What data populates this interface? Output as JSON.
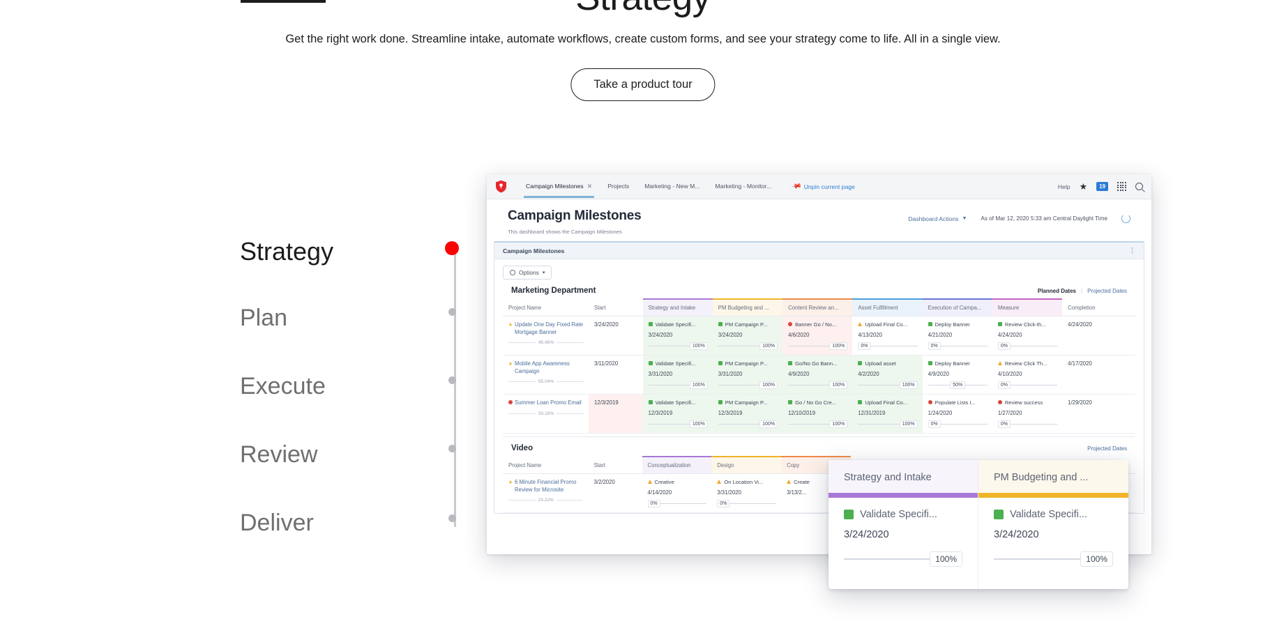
{
  "hero": {
    "title": "Strategy",
    "subtitle": "Get the right work done. Streamline intake, automate workflows, create custom forms, and see your strategy come to life. All in a single view.",
    "cta": "Take a product tour"
  },
  "stepper": {
    "items": [
      {
        "label": "Strategy",
        "active": true
      },
      {
        "label": "Plan",
        "active": false
      },
      {
        "label": "Execute",
        "active": false
      },
      {
        "label": "Review",
        "active": false
      },
      {
        "label": "Deliver",
        "active": false
      }
    ]
  },
  "app": {
    "nav": {
      "logo": "shield-logo-icon",
      "tabs": [
        {
          "label": "Campaign Milestones",
          "active": true,
          "closable": true
        },
        {
          "label": "Projects",
          "active": false,
          "closable": false
        },
        {
          "label": "Marketing - New M...",
          "active": false,
          "closable": false
        },
        {
          "label": "Marketing - Monitor...",
          "active": false,
          "closable": false
        }
      ],
      "unpin_label": "Unpin current page",
      "help_label": "Help",
      "badge_count": "19",
      "icons": [
        "pin-icon",
        "star-icon",
        "notification-badge",
        "grid-icon",
        "search-icon"
      ]
    },
    "header": {
      "title": "Campaign Milestones",
      "subtitle": "This dashboard shows the Campaign Milestones",
      "actions_label": "Dashboard Actions",
      "as_of": "As of  Mar 12, 2020 5:33 am Central Daylight Time",
      "refresh_icon": "refresh-icon"
    },
    "panel": {
      "title": "Campaign Milestones",
      "info_icon": "info-icon",
      "options_label": "Options"
    },
    "dates_toggle": {
      "planned": "Planned Dates",
      "projected": "Projected Dates",
      "separator": "|"
    },
    "marketing": {
      "section_title": "Marketing Department",
      "columns": [
        {
          "label": "Project Name",
          "color": "",
          "bg": "bg-white"
        },
        {
          "label": "Start",
          "color": "",
          "bg": "bg-white"
        },
        {
          "label": "Strategy and Intake",
          "color": "#a779d6",
          "bg": "bg-purple"
        },
        {
          "label": "PM Budgeting and ...",
          "color": "#f0b429",
          "bg": "bg-yellow"
        },
        {
          "label": "Content Review an...",
          "color": "#f08a4b",
          "bg": "bg-orange"
        },
        {
          "label": "Asset Fulfillment",
          "color": "#4a9fe0",
          "bg": "bg-blue"
        },
        {
          "label": "Execution of Campa...",
          "color": "#6b74d6",
          "bg": "bg-indigo"
        },
        {
          "label": "Measure",
          "color": "#c864c0",
          "bg": "bg-pink"
        },
        {
          "label": "Completion",
          "color": "",
          "bg": "bg-white"
        }
      ],
      "rows": [
        {
          "project": "Update One Day Fixed Rate Mortgage Banner",
          "project_pct": "45.45%",
          "start": "3/24/2020",
          "completion": "4/24/2020",
          "cells": [
            {
              "status": "sq-green",
              "task": "Validate Specifi...",
              "date": "3/24/2020",
              "pct": "100%",
              "bg": "bg-green"
            },
            {
              "status": "sq-green",
              "task": "PM Campaign P...",
              "date": "3/24/2020",
              "pct": "100%",
              "bg": "bg-green"
            },
            {
              "status": "cir-red",
              "task": "Banner Go / No...",
              "date": "4/6/2020",
              "pct": "100%",
              "bg": "bg-red"
            },
            {
              "status": "tri-orange",
              "task": "Upload Final Co...",
              "date": "4/13/2020",
              "pct": "0%",
              "bg": "bg-white"
            },
            {
              "status": "sq-green",
              "task": "Deploy Banner",
              "date": "4/21/2020",
              "pct": "0%",
              "bg": "bg-white"
            },
            {
              "status": "sq-green",
              "task": "Review Click-th...",
              "date": "4/24/2020",
              "pct": "0%",
              "bg": "bg-white"
            }
          ]
        },
        {
          "project": "Mobile App Awareness Campaign",
          "project_pct": "55.04%",
          "start": "3/11/2020",
          "completion": "4/17/2020",
          "cells": [
            {
              "status": "sq-green",
              "task": "Validate Specifi...",
              "date": "3/31/2020",
              "pct": "100%",
              "bg": "bg-green"
            },
            {
              "status": "sq-green",
              "task": "PM Campaign P...",
              "date": "3/31/2020",
              "pct": "100%",
              "bg": "bg-green"
            },
            {
              "status": "sq-green",
              "task": "Go/No Go Bann...",
              "date": "4/9/2020",
              "pct": "100%",
              "bg": "bg-green"
            },
            {
              "status": "sq-green",
              "task": "Upload asset",
              "date": "4/2/2020",
              "pct": "100%",
              "bg": "bg-green"
            },
            {
              "status": "sq-green",
              "task": "Deploy Banner",
              "date": "4/9/2020",
              "pct": "50%",
              "bg": "bg-white"
            },
            {
              "status": "tri-orange",
              "task": "Review Click Th...",
              "date": "4/10/2020",
              "pct": "0%",
              "bg": "bg-white"
            }
          ]
        },
        {
          "project": "Summer Loan Promo Email",
          "project_pct": "93.18%",
          "start": "12/3/2019",
          "completion": "1/29/2020",
          "cells": [
            {
              "status": "sq-green",
              "task": "Validate Specifi...",
              "date": "12/3/2019",
              "pct": "100%",
              "bg": "bg-green"
            },
            {
              "status": "sq-green",
              "task": "PM Campaign P...",
              "date": "12/3/2019",
              "pct": "100%",
              "bg": "bg-green"
            },
            {
              "status": "sq-green",
              "task": "Go / No Go Cre...",
              "date": "12/10/2019",
              "pct": "100%",
              "bg": "bg-green"
            },
            {
              "status": "sq-green",
              "task": "Upload Final Co...",
              "date": "12/31/2019",
              "pct": "100%",
              "bg": "bg-green"
            },
            {
              "status": "cir-red",
              "task": "Populate Lists I...",
              "date": "1/24/2020",
              "pct": "0%",
              "bg": "bg-white"
            },
            {
              "status": "cir-red",
              "task": "Review success",
              "date": "1/27/2020",
              "pct": "0%",
              "bg": "bg-white"
            }
          ]
        }
      ]
    },
    "video": {
      "section_title": "Video",
      "columns": [
        {
          "label": "Project Name",
          "color": "",
          "bg": "bg-white"
        },
        {
          "label": "Start",
          "color": "",
          "bg": "bg-white"
        },
        {
          "label": "Conceptualization",
          "color": "#a779d6",
          "bg": "bg-purple"
        },
        {
          "label": "Design",
          "color": "#f0b429",
          "bg": "bg-yellow"
        },
        {
          "label": "Copy",
          "color": "#f08a4b",
          "bg": "bg-orange"
        }
      ],
      "rows": [
        {
          "project": "6 Minute Financial Promo Review for Microsite",
          "project_pct": "23.22%",
          "start": "3/2/2020",
          "cells": [
            {
              "status": "tri-orange",
              "task": "Creative",
              "date": "4/14/2020",
              "pct": "0%",
              "bg": "bg-white"
            },
            {
              "status": "tri-orange",
              "task": "On Location Vi...",
              "date": "3/31/2020",
              "pct": "0%",
              "bg": "bg-white"
            },
            {
              "status": "tri-orange",
              "task": "Create",
              "date": "3/13/2...",
              "pct": "",
              "bg": "bg-white"
            }
          ]
        }
      ]
    }
  },
  "magnifier": {
    "columns": [
      {
        "header": "Strategy and Intake",
        "bar_color": "#a779d6",
        "status": "sq-green",
        "task": "Validate Specifi...",
        "date": "3/24/2020",
        "pct": "100%",
        "header_bg": "#f7f4fc"
      },
      {
        "header": "PM Budgeting and ...",
        "bar_color": "#f0b429",
        "status": "sq-green",
        "task": "Validate Specifi...",
        "date": "3/24/2020",
        "pct": "100%",
        "header_bg": "#fdf8ec"
      }
    ]
  },
  "colors": {
    "accent_red": "#ff0000",
    "link_blue": "#2b7bd4",
    "text_dark": "#1c1c1c",
    "text_muted": "#6f6f72"
  }
}
